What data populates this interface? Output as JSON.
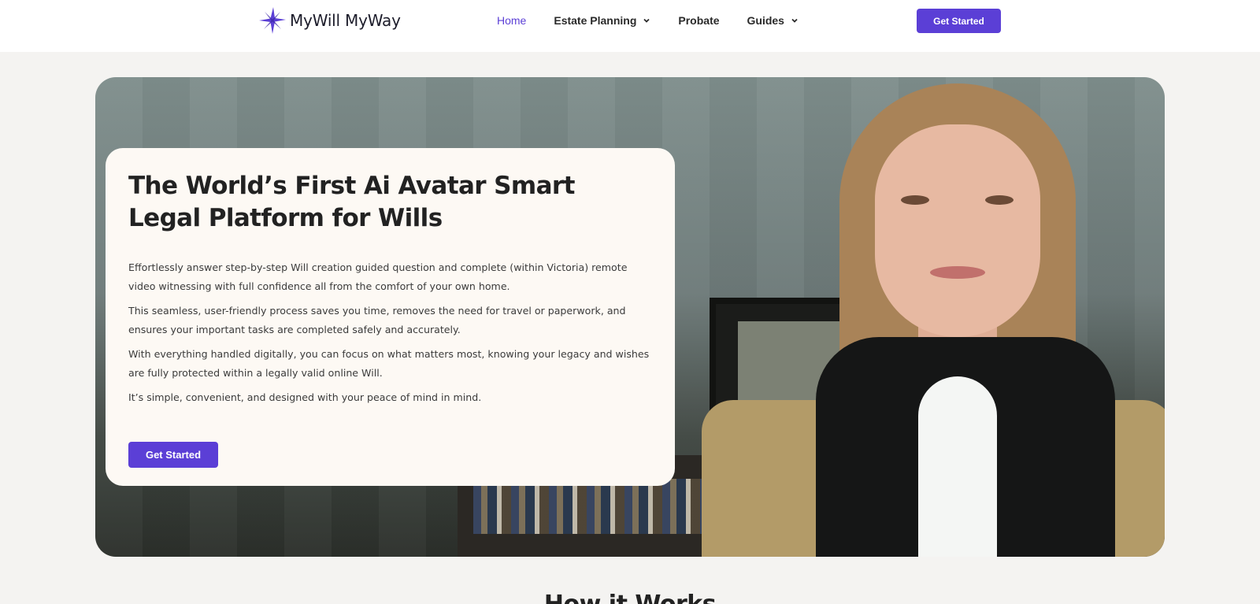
{
  "brand": {
    "name": "MyWill MyWay",
    "logo_icon": "four-point-star-icon",
    "accent": "#5b3fd6"
  },
  "nav": {
    "items": [
      {
        "label": "Home",
        "active": true
      },
      {
        "label": "Estate Planning",
        "dropdown": true
      },
      {
        "label": "Probate"
      },
      {
        "label": "Guides",
        "dropdown": true
      }
    ],
    "cta_label": "Get Started"
  },
  "hero": {
    "title": "The World’s First Ai Avatar Smart Legal Platform for Wills",
    "paragraphs": [
      "Effortlessly answer step-by-step Will creation guided question and complete (within Victoria) remote video witnessing with full confidence all from the comfort of your own home.",
      "This seamless, user-friendly process saves you time, removes the need for travel or paperwork, and ensures your important tasks are completed safely and accurately.",
      "With everything handled digitally, you can focus on what matters most, knowing your legacy and wishes are fully protected within a legally valid online Will.",
      "It’s simple, convenient, and designed with your peace of mind in mind."
    ],
    "cta_label": "Get Started"
  },
  "next_section": {
    "title": "How it Works"
  }
}
